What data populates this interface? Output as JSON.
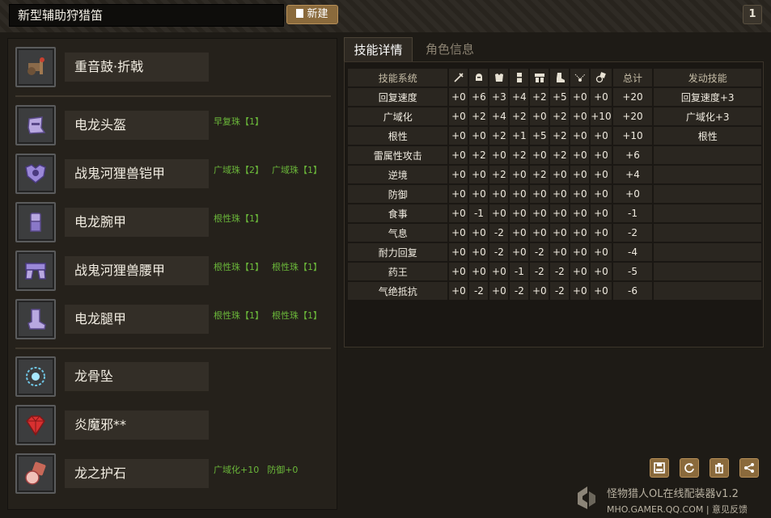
{
  "header": {
    "title_value": "新型辅助狩猎笛",
    "new_button": "新建",
    "page_number": "1"
  },
  "equipment": [
    {
      "name": "重音鼓·折戟",
      "gems": [],
      "icon": "weapon-hunting-horn-icon"
    },
    {
      "name": "电龙头盔",
      "gems": [
        "早复珠【1】"
      ],
      "icon": "helmet-icon"
    },
    {
      "name": "战鬼河狸兽铠甲",
      "gems": [
        "广域珠【2】",
        "广域珠【1】"
      ],
      "icon": "chest-armor-icon"
    },
    {
      "name": "电龙腕甲",
      "gems": [
        "根性珠【1】"
      ],
      "icon": "gauntlet-icon"
    },
    {
      "name": "战鬼河狸兽腰甲",
      "gems": [
        "根性珠【1】",
        "根性珠【1】"
      ],
      "icon": "waist-armor-icon"
    },
    {
      "name": "电龙腿甲",
      "gems": [
        "根性珠【1】",
        "根性珠【1】"
      ],
      "icon": "leg-armor-icon"
    },
    {
      "name": "龙骨坠",
      "gems": [],
      "icon": "pendant-icon"
    },
    {
      "name": "炎魔邪**",
      "gems": [],
      "icon": "ruby-gem-icon"
    },
    {
      "name": "龙之护石",
      "gems": [
        "广域化+10",
        "防御+0"
      ],
      "icon": "charm-stone-icon"
    }
  ],
  "tabs": {
    "skills_detail": "技能详情",
    "character_info": "角色信息"
  },
  "skills_table": {
    "header_skill": "技能系统",
    "header_total": "总计",
    "header_active": "发动技能",
    "column_icons": [
      "weapon-icon",
      "helmet-icon",
      "chest-icon",
      "arm-icon",
      "waist-icon",
      "leg-icon",
      "pendant-icon",
      "charm-icon"
    ],
    "rows": [
      {
        "skill": "回复速度",
        "values": [
          "+0",
          "+6",
          "+3",
          "+4",
          "+2",
          "+5",
          "+0",
          "+0"
        ],
        "total": "+20",
        "active": "回复速度+3"
      },
      {
        "skill": "广域化",
        "values": [
          "+0",
          "+2",
          "+4",
          "+2",
          "+0",
          "+2",
          "+0",
          "+10"
        ],
        "total": "+20",
        "active": "广域化+3"
      },
      {
        "skill": "根性",
        "values": [
          "+0",
          "+0",
          "+2",
          "+1",
          "+5",
          "+2",
          "+0",
          "+0"
        ],
        "total": "+10",
        "active": "根性"
      },
      {
        "skill": "雷属性攻击",
        "values": [
          "+0",
          "+2",
          "+0",
          "+2",
          "+0",
          "+2",
          "+0",
          "+0"
        ],
        "total": "+6",
        "active": ""
      },
      {
        "skill": "逆境",
        "values": [
          "+0",
          "+0",
          "+2",
          "+0",
          "+2",
          "+0",
          "+0",
          "+0"
        ],
        "total": "+4",
        "active": ""
      },
      {
        "skill": "防御",
        "values": [
          "+0",
          "+0",
          "+0",
          "+0",
          "+0",
          "+0",
          "+0",
          "+0"
        ],
        "total": "+0",
        "active": ""
      },
      {
        "skill": "食事",
        "values": [
          "+0",
          "-1",
          "+0",
          "+0",
          "+0",
          "+0",
          "+0",
          "+0"
        ],
        "total": "-1",
        "active": ""
      },
      {
        "skill": "气息",
        "values": [
          "+0",
          "+0",
          "-2",
          "+0",
          "+0",
          "+0",
          "+0",
          "+0"
        ],
        "total": "-2",
        "active": ""
      },
      {
        "skill": "耐力回复",
        "values": [
          "+0",
          "+0",
          "-2",
          "+0",
          "-2",
          "+0",
          "+0",
          "+0"
        ],
        "total": "-4",
        "active": ""
      },
      {
        "skill": "药王",
        "values": [
          "+0",
          "+0",
          "+0",
          "-1",
          "-2",
          "-2",
          "+0",
          "+0"
        ],
        "total": "-5",
        "active": ""
      },
      {
        "skill": "气绝抵抗",
        "values": [
          "+0",
          "-2",
          "+0",
          "-2",
          "+0",
          "-2",
          "+0",
          "+0"
        ],
        "total": "-6",
        "active": ""
      }
    ]
  },
  "actions": [
    {
      "name": "save-button",
      "icon": "save-icon"
    },
    {
      "name": "refresh-button",
      "icon": "refresh-icon"
    },
    {
      "name": "delete-button",
      "icon": "trash-icon"
    },
    {
      "name": "share-button",
      "icon": "share-icon"
    }
  ],
  "footer": {
    "title": "怪物猎人OL在线配装器v1.2",
    "site": "MHO.GAMER.QQ.COM | 意见反馈"
  },
  "colors": {
    "accent_button": "#8a6a3c",
    "gem_text": "#6bb83a",
    "background": "#1e1b16"
  }
}
